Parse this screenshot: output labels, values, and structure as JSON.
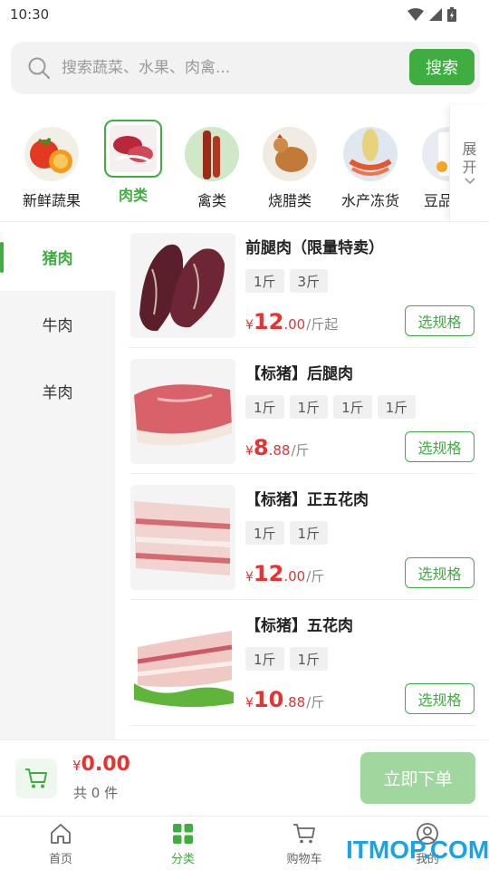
{
  "status_bar": {
    "time": "10:30"
  },
  "search": {
    "placeholder": "搜索蔬菜、水果、肉禽...",
    "button_label": "搜索"
  },
  "categories": [
    {
      "label": "新鲜蔬果",
      "icon": "vegetables-fruits-image"
    },
    {
      "label": "肉类",
      "icon": "meat-image",
      "active": true
    },
    {
      "label": "禽类",
      "icon": "poultry-image"
    },
    {
      "label": "烧腊类",
      "icon": "roast-image"
    },
    {
      "label": "水产冻货",
      "icon": "seafood-image"
    },
    {
      "label": "豆品",
      "icon": "tofu-image"
    }
  ],
  "expand_label": {
    "line1": "展",
    "line2": "开"
  },
  "side_menu": [
    {
      "label": "猪肉",
      "active": true
    },
    {
      "label": "牛肉"
    },
    {
      "label": "羊肉"
    }
  ],
  "products": [
    {
      "name": "前腿肉（限量特卖）",
      "tags": [
        "1斤",
        "3斤"
      ],
      "currency": "¥",
      "price_int": "12",
      "price_dec": ".00",
      "unit": "/斤起",
      "button": "选规格"
    },
    {
      "name": "【标猪】后腿肉",
      "tags": [
        "1斤",
        "1斤",
        "1斤",
        "1斤"
      ],
      "currency": "¥",
      "price_int": "8",
      "price_dec": ".88",
      "unit": "/斤",
      "button": "选规格"
    },
    {
      "name": "【标猪】正五花肉",
      "tags": [
        "1斤",
        "1斤"
      ],
      "currency": "¥",
      "price_int": "12",
      "price_dec": ".00",
      "unit": "/斤",
      "button": "选规格"
    },
    {
      "name": "【标猪】五花肉",
      "tags": [
        "1斤",
        "1斤"
      ],
      "currency": "¥",
      "price_int": "10",
      "price_dec": ".88",
      "unit": "/斤",
      "button": "选规格"
    }
  ],
  "cart": {
    "currency": "¥",
    "total": "0.00",
    "count": "共 0 件",
    "order_button": "立即下单"
  },
  "tabs": [
    {
      "label": "首页",
      "icon": "home-icon"
    },
    {
      "label": "分类",
      "icon": "category-grid-icon",
      "active": true
    },
    {
      "label": "购物车",
      "icon": "cart-icon"
    },
    {
      "label": "我的",
      "icon": "user-icon"
    }
  ],
  "watermark": "ITMOP.COM",
  "colors": {
    "accent": "#3dae3f",
    "price": "#e8322f",
    "accent_light": "#9fd79f"
  }
}
